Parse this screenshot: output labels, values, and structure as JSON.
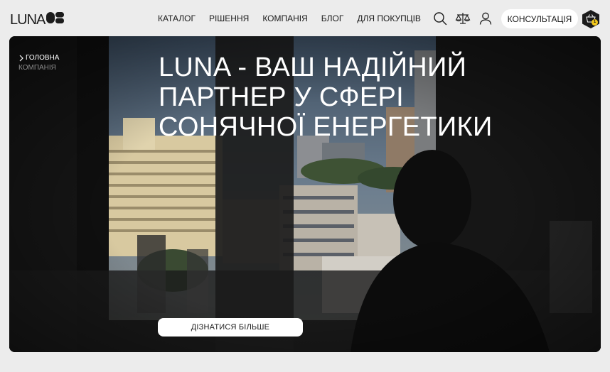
{
  "header": {
    "logo_text": "LUNA",
    "nav": [
      "КАТАЛОГ",
      "РІШЕННЯ",
      "КОМПАНІЯ",
      "БЛОГ",
      "ДЛЯ ПОКУПЦІВ"
    ],
    "consult_label": "КОНСУЛЬТАЦІЯ",
    "cart_count": "1",
    "icons": [
      "search-icon",
      "compare-scales-icon",
      "user-icon",
      "cart-icon"
    ]
  },
  "breadcrumb": {
    "home": "ГОЛОВНА",
    "current": "КОМПАНІЯ"
  },
  "hero": {
    "title_lines": [
      "LUNA - ВАШ НАДІЙНИЙ",
      "ПАРТНЕР У СФЕРІ",
      "СОНЯЧНОЇ ЕНЕРГЕТИКИ"
    ],
    "cta_label": "ДІЗНАТИСЯ БІЛЬШЕ"
  },
  "colors": {
    "page_bg": "#ececec",
    "text_dark": "#1b1b1b",
    "accent_yellow": "#f2c81c",
    "hero_bg": "#121212"
  }
}
